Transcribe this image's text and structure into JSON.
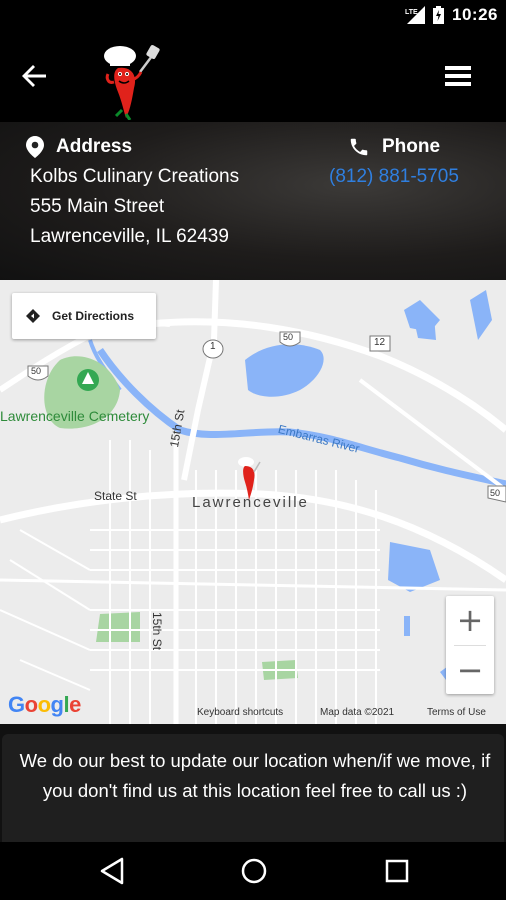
{
  "status_bar": {
    "time": "10:26",
    "network": "LTE"
  },
  "app_bar": {
    "back_icon": "arrow-left-icon",
    "logo": "chef-pepper-logo",
    "menu_icon": "hamburger-menu-icon"
  },
  "info": {
    "address_label": "Address",
    "address_lines": [
      "Kolbs Culinary Creations",
      "555 Main Street",
      "Lawrenceville, IL 62439"
    ],
    "phone_label": "Phone",
    "phone": "(812) 881-5705",
    "phone_color": "#2f7fe0"
  },
  "map": {
    "directions_label": "Get Directions",
    "labels": {
      "cemetery": "Lawrenceville Cemetery",
      "town": "Lawrenceville",
      "state_st": "State St",
      "fifteenth_top": "15th St",
      "fifteenth_bottom": "15th St",
      "river": "Embarras River",
      "hwy_50_left": "50",
      "hwy_50_mid": "50",
      "hwy_50_right": "50",
      "hwy_1": "1",
      "hwy_12": "12"
    },
    "zoom_in": "+",
    "zoom_out": "−",
    "google": "Google",
    "keyboard_shortcuts": "Keyboard shortcuts",
    "map_data": "Map data ©2021",
    "terms": "Terms of Use",
    "colors": {
      "water": "#8ab4f8",
      "park": "#a8d5a2",
      "road": "#ffffff"
    }
  },
  "note": {
    "text": "We do our best to update our location when/if we move, if you don't find us at this location feel free to call us :)"
  },
  "nav_bar": {
    "back": "nav-back-icon",
    "home": "nav-home-icon",
    "recents": "nav-recents-icon"
  }
}
